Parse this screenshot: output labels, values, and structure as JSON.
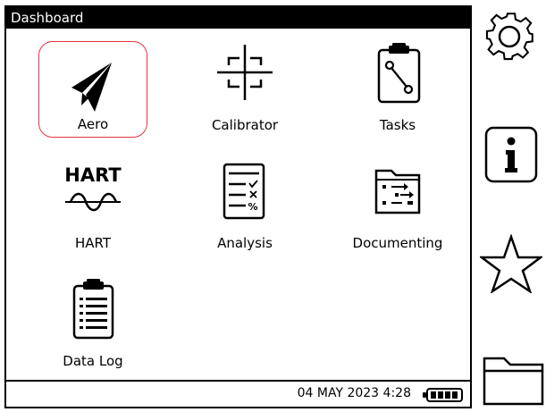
{
  "screen": {
    "title": "Dashboard"
  },
  "tiles": [
    {
      "label": "Aero",
      "icon": "paper-plane-icon",
      "selected": true
    },
    {
      "label": "Calibrator",
      "icon": "crosshair-icon",
      "selected": false
    },
    {
      "label": "Tasks",
      "icon": "clipboard-wrench-icon",
      "selected": false
    },
    {
      "label": "HART",
      "icon": "hart-logo-icon",
      "icon_text": "HART",
      "selected": false
    },
    {
      "label": "Analysis",
      "icon": "checklist-document-icon",
      "selected": false
    },
    {
      "label": "Documenting",
      "icon": "folder-flow-icon",
      "selected": false
    },
    {
      "label": "Data Log",
      "icon": "clipboard-list-icon",
      "selected": false
    }
  ],
  "status": {
    "date": "04 MAY 2023",
    "time": "4:28",
    "battery_level": 1.0
  },
  "side_buttons": [
    {
      "icon": "gear-icon"
    },
    {
      "icon": "info-icon"
    },
    {
      "icon": "star-icon"
    },
    {
      "icon": "folder-icon"
    }
  ],
  "colors": {
    "selected_border": "#e2363e",
    "titlebar_bg": "#000000"
  }
}
